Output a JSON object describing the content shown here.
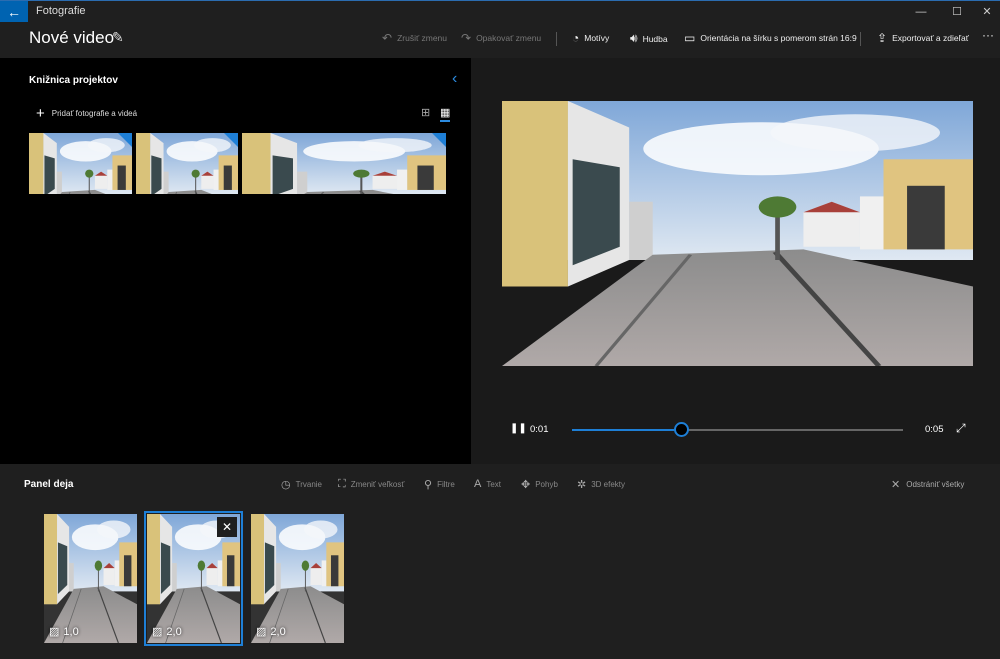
{
  "window": {
    "app_name": "Fotografie",
    "minimize": "—",
    "maximize": "☐",
    "close": "✕"
  },
  "toolbar": {
    "project_title": "Nové video",
    "undo": "Zrušiť zmenu",
    "redo": "Opakovať zmenu",
    "themes": "Motívy",
    "music": "Hudba",
    "orientation": "Orientácia na šírku s pomerom strán 16:9",
    "export": "Exportovať a zdieľať",
    "more": "···"
  },
  "library": {
    "title": "Knižnica projektov",
    "add_label": "Pridať fotografie a videá"
  },
  "player": {
    "current_time": "0:01",
    "total_time": "0:05",
    "progress": 0.33
  },
  "storyboard": {
    "title": "Panel deja",
    "tools": [
      "Trvanie",
      "Zmeniť veľkosť",
      "Filtre",
      "Text",
      "Pohyb",
      "3D efekty"
    ],
    "clear_all": "Odstrániť všetky",
    "clips": [
      {
        "duration": "1,0"
      },
      {
        "duration": "2,0",
        "selected": true
      },
      {
        "duration": "2,0"
      }
    ]
  },
  "colors": {
    "accent": "#1e7fd6",
    "panel": "#1f1f1f",
    "background": "#000000"
  }
}
